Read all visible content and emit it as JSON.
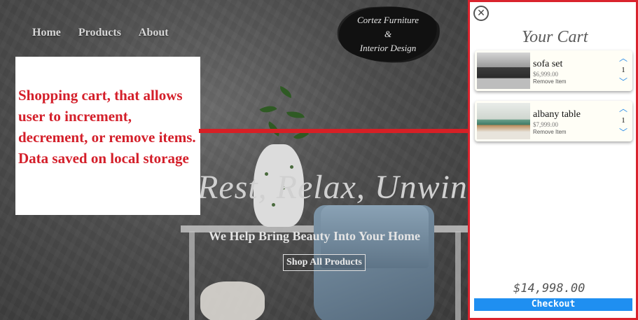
{
  "nav": {
    "items": [
      "Home",
      "Products",
      "About"
    ]
  },
  "logo": {
    "line1": "Cortez Furniture",
    "line2": "&",
    "line3": "Interior Design"
  },
  "hero": {
    "tagline": "Rest, Relax, Unwind",
    "subline": "We Help Bring Beauty Into Your Home",
    "cta": "Shop All Products"
  },
  "annotation": {
    "text": "Shopping cart, that allows user to increment, decrement, or remove items. Data saved on local storage",
    "color": "#d41f2a"
  },
  "cart": {
    "close_icon": "close-icon",
    "title": "Your Cart",
    "items": [
      {
        "name": "sofa set",
        "price": "$6,999.00",
        "remove": "Remove Item",
        "qty": "1"
      },
      {
        "name": "albany table",
        "price": "$7,999.00",
        "remove": "Remove Item",
        "qty": "1"
      }
    ],
    "total": "$14,998.00",
    "checkout": "Checkout",
    "accent": "#1f8ff1",
    "border_color": "#d9232d"
  }
}
